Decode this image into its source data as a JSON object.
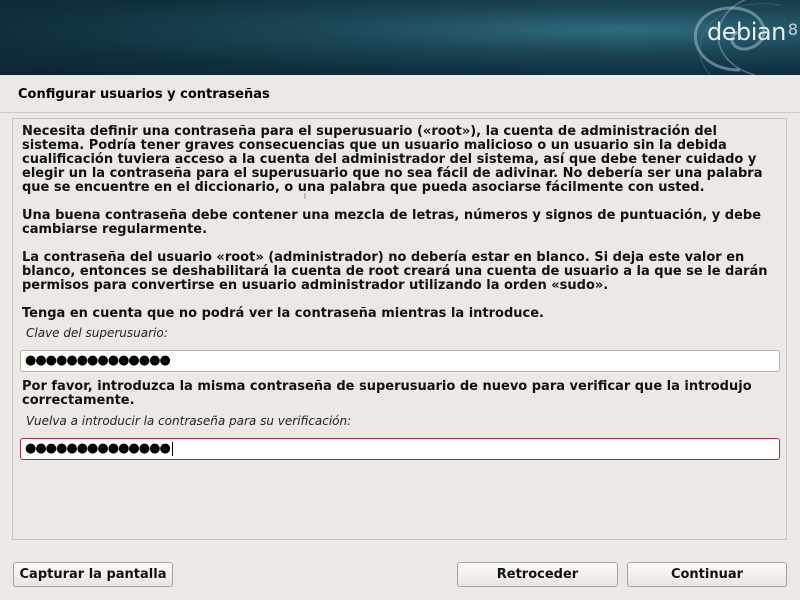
{
  "header": {
    "brand": "debian",
    "version": "8"
  },
  "page_title": "Configurar usuarios y contraseñas",
  "paragraphs": [
    "Necesita definir una contraseña para el superusuario («root»), la cuenta de administración del sistema. Podría tener graves consecuencias que un usuario malicioso o un usuario sin la debida cualificación tuviera acceso a la cuenta del administrador del sistema, así que debe tener cuidado y elegir un la contraseña para el superusuario que no sea fácil de adivinar. No debería ser una palabra que se encuentre en el diccionario, o una palabra que pueda asociarse fácilmente con usted.",
    "Una buena contraseña debe contener una mezcla de letras, números y signos de puntuación, y debe cambiarse regularmente.",
    "La contraseña del usuario «root» (administrador) no debería estar en blanco. Si deja este valor en blanco, entonces se deshabilitará la cuenta de root creará una cuenta de usuario a la que se le darán permisos para convertirse en usuario administrador utilizando la orden «sudo».",
    "Tenga en cuenta que no podrá ver la contraseña mientras la introduce."
  ],
  "root_password": {
    "label": "Clave del superusuario:",
    "value": "●●●●●●●●●●●●●●"
  },
  "confirm_instruction": "Por favor, introduzca la misma contraseña de superusuario de nuevo para verificar que la introdujo correctamente.",
  "confirm_password": {
    "label": "Vuelva a introducir la contraseña para su verificación:",
    "value": "●●●●●●●●●●●●●●"
  },
  "buttons": {
    "screenshot": "Capturar la pantalla",
    "back": "Retroceder",
    "continue": "Continuar"
  }
}
